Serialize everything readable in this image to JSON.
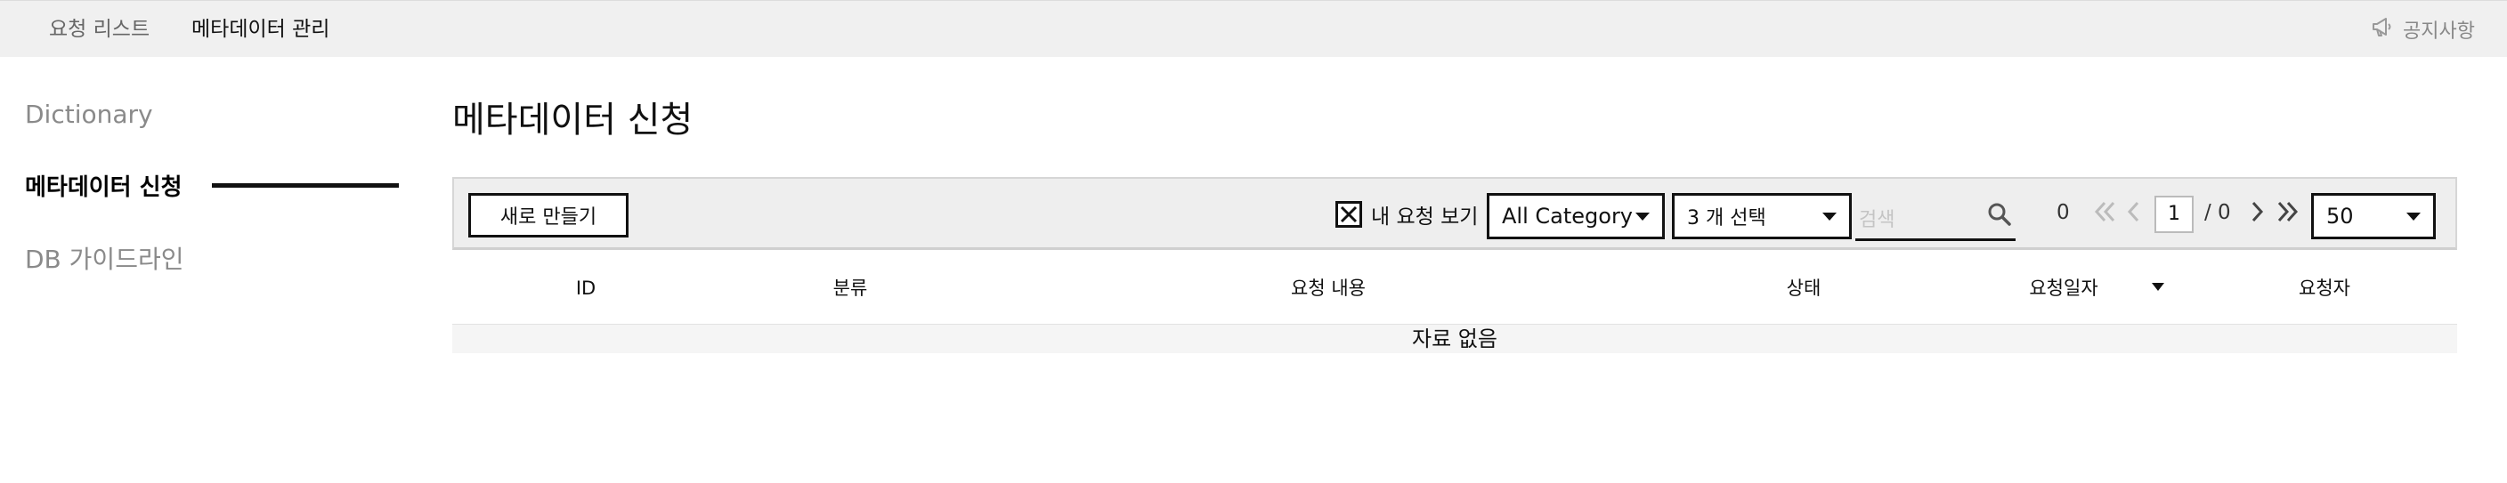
{
  "topbar": {
    "tabs": [
      {
        "label": "요청 리스트"
      },
      {
        "label": "메타데이터 관리"
      }
    ],
    "notice_label": "공지사항",
    "notice_icon": "megaphone-icon"
  },
  "sidebar": {
    "items": [
      {
        "label": "Dictionary",
        "active": false
      },
      {
        "label": "메타데이터 신청",
        "active": true
      },
      {
        "label": "DB 가이드라인",
        "active": false
      }
    ]
  },
  "main": {
    "title": "메타데이터 신청",
    "toolbar": {
      "new_button_label": "새로 만들기",
      "my_requests_label": "내 요청 보기",
      "my_requests_checked": true,
      "category_select_value": "All Category",
      "status_select_value": "3 개 선택",
      "search_placeholder": "검색",
      "total_count": "0",
      "current_page": "1",
      "page_total": "/ 0",
      "page_size_value": "50"
    },
    "table": {
      "columns": [
        "ID",
        "분류",
        "요청 내용",
        "상태",
        "요청일자",
        "요청자"
      ],
      "empty_text": "자료 없음"
    }
  },
  "colors": {
    "topbar_bg": "#f0f0f0",
    "toolbar_bg": "#eeeeee",
    "text_primary": "#111111",
    "text_muted": "#8a8a8a"
  }
}
